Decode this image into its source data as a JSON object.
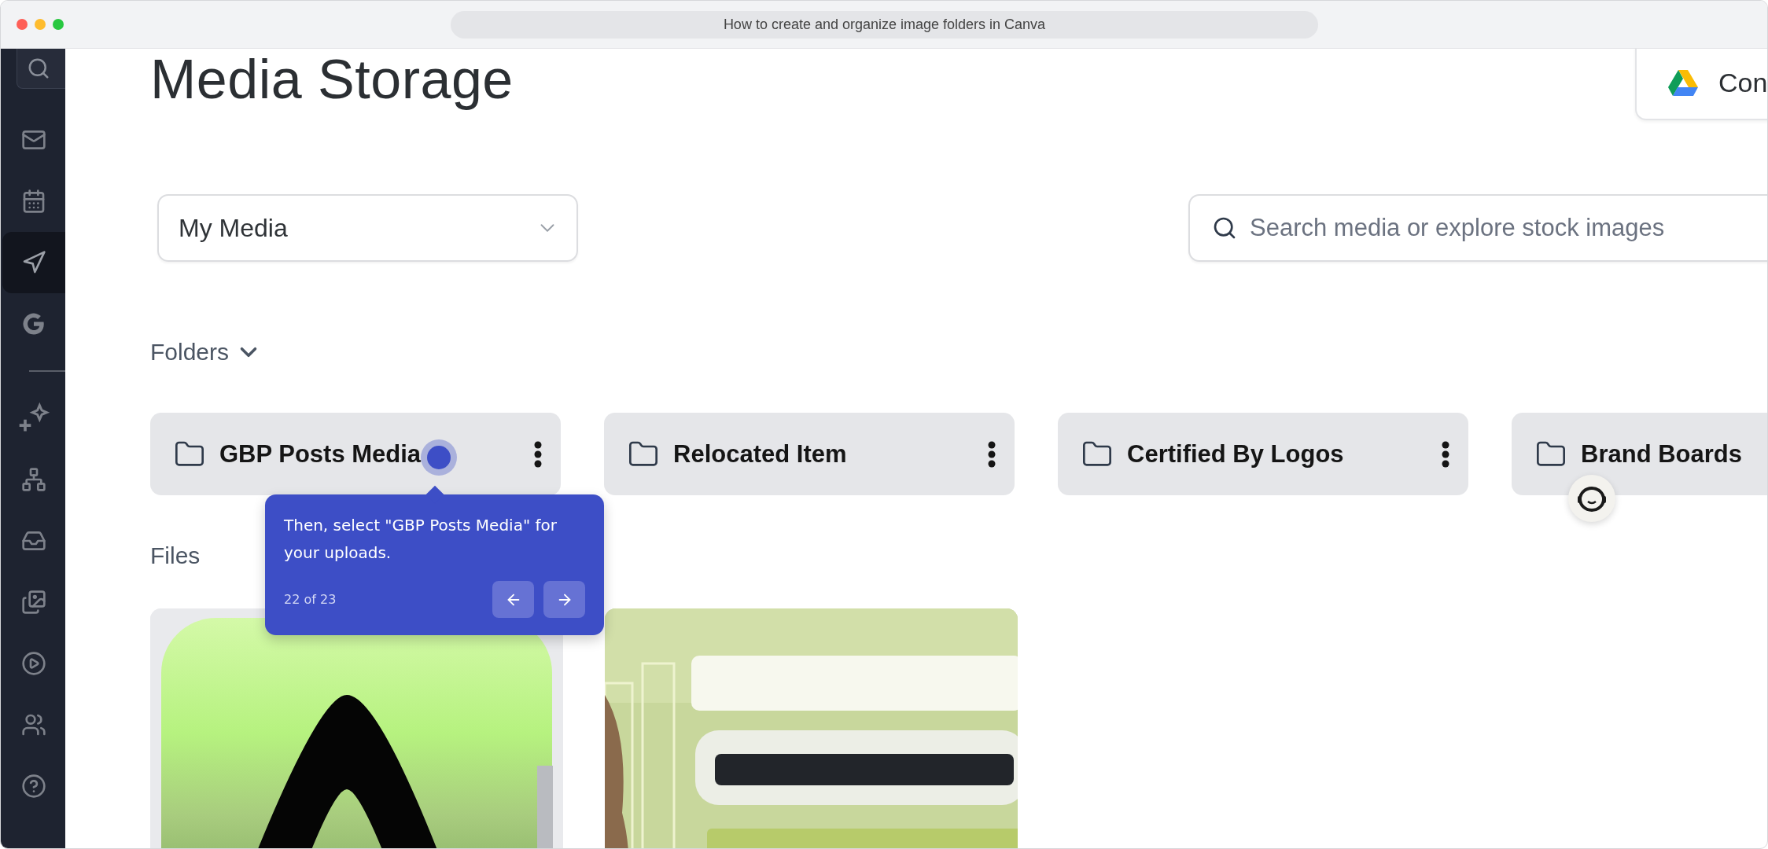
{
  "window": {
    "title": "How to create and organize image folders in Canva"
  },
  "sidebar": {
    "items": [
      {
        "selected": false
      },
      {
        "selected": false
      },
      {
        "selected": true
      },
      {
        "selected": false
      },
      {
        "selected": false
      },
      {
        "selected": false
      },
      {
        "selected": false
      },
      {
        "selected": false
      },
      {
        "selected": false
      },
      {
        "selected": false
      },
      {
        "selected": false
      }
    ]
  },
  "header": {
    "title": "Media Storage",
    "drive_button": {
      "label": "Con"
    }
  },
  "media_select": {
    "value": "My Media"
  },
  "search": {
    "placeholder": "Search media or explore stock images"
  },
  "folders": {
    "heading": "Folders",
    "expanded": true,
    "items": [
      {
        "name": "GBP Posts Media",
        "menu": true
      },
      {
        "name": "Relocated Item",
        "menu": true
      },
      {
        "name": "Certified By Logos",
        "menu": true
      },
      {
        "name": "Brand Boards",
        "menu": false
      }
    ]
  },
  "files": {
    "heading": "Files"
  },
  "tooltip": {
    "text": "Then, select \"GBP Posts Media\" for your uploads.",
    "step": "22 of 23"
  }
}
